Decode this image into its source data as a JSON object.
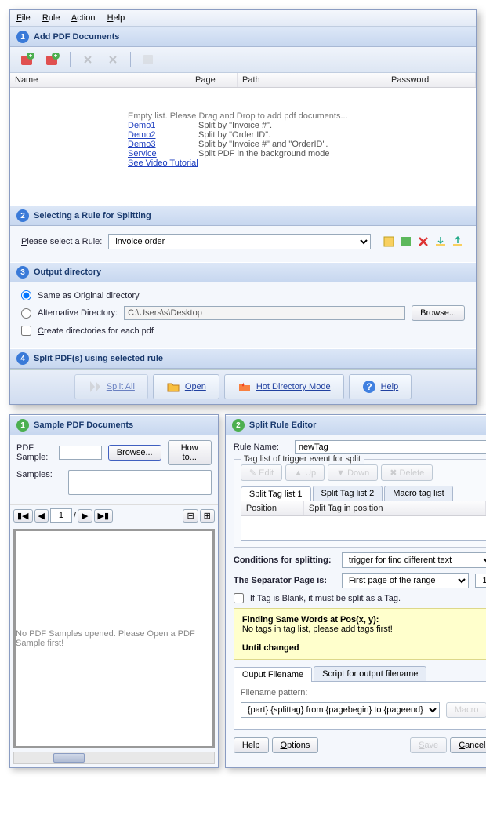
{
  "menu": {
    "file": "File",
    "rule": "Rule",
    "action": "Action",
    "help": "Help"
  },
  "s1": {
    "title": "Add PDF Documents",
    "cols": {
      "name": "Name",
      "page": "Page",
      "path": "Path",
      "password": "Password"
    },
    "empty": "Empty list. Please Drag and Drop to add pdf documents...",
    "demos": [
      {
        "link": "Demo1",
        "desc": "Split by \"Invoice #\"."
      },
      {
        "link": "Demo2",
        "desc": "Split by \"Order ID\"."
      },
      {
        "link": "Demo3",
        "desc": "Split by \"Invoice #\" and \"OrderID\"."
      },
      {
        "link": "Service",
        "desc": "Split PDF in the background mode"
      }
    ],
    "tutorial": "See Video Tutorial"
  },
  "s2": {
    "title": "Selecting a Rule for Splitting",
    "label": "Please select a Rule:",
    "value": "invoice order"
  },
  "s3": {
    "title": "Output directory",
    "opt1": "Same as Original directory",
    "opt2": "Alternative Directory:",
    "path": "C:\\Users\\s\\Desktop",
    "browse": "Browse...",
    "chk": "Create directories for each pdf"
  },
  "s4": {
    "title": "Split PDF(s) using selected rule",
    "split": "Split All",
    "open": "Open",
    "hot": "Hot Directory Mode",
    "help": "Help"
  },
  "left": {
    "title": "Sample PDF Documents",
    "pdf_sample": "PDF Sample:",
    "browse": "Browse...",
    "howto": "How to...",
    "samples": "Samples:",
    "page_of": "/",
    "empty_preview": "No PDF Samples opened. Please Open a PDF Sample first!",
    "page_val": "1"
  },
  "right": {
    "title": "Split Rule Editor",
    "rule_name_label": "Rule Name:",
    "rule_name": "newTag",
    "taglist_title": "Tag list of trigger event for split",
    "edit": "Edit",
    "up": "Up",
    "down": "Down",
    "delete": "Delete",
    "tabs": [
      "Split Tag list 1",
      "Split Tag list 2",
      "Macro tag list"
    ],
    "tag_cols": {
      "pos": "Position",
      "tag": "Split Tag in position"
    },
    "cond_label": "Conditions for splitting:",
    "cond_value": "trigger for find different text",
    "sep_label": "The Separator Page is:",
    "sep_value": "First page of the range",
    "sep_num": "1",
    "blank_chk": "If Tag is Blank, it must be split as a Tag.",
    "yellow_title": "Finding Same Words at Pos(x, y):",
    "yellow_msg": "No tags in tag list, please add tags first!",
    "yellow_until": "Until changed",
    "ftabs": [
      "Ouput Filename",
      "Script for output filename"
    ],
    "fn_label": "Filename pattern:",
    "fn_value": "{part} {splittag} from {pagebegin} to {pageend}",
    "macro": "Macro",
    "help": "Help",
    "options": "Options",
    "save": "Save",
    "cancel": "Cancel"
  }
}
